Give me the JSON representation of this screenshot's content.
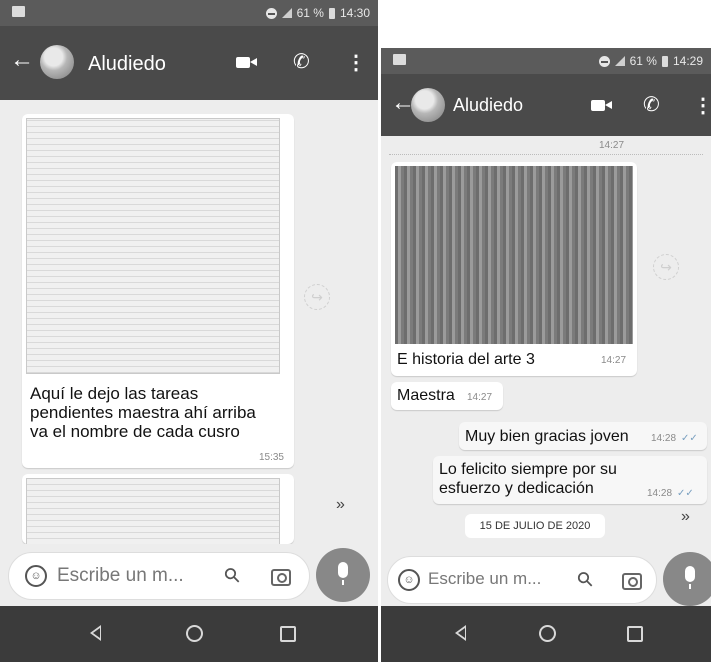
{
  "left": {
    "status": {
      "battery": "61 %",
      "time": "14:30"
    },
    "header": {
      "contact": "Aludiedo"
    },
    "message": {
      "caption": "Aquí le dejo las tareas pendientes maestra  ahí arriba va el nombre de cada cusro",
      "time": "15:35"
    },
    "composer": {
      "placeholder": "Escribe un m..."
    }
  },
  "right": {
    "status": {
      "battery": "61 %",
      "time": "14:29"
    },
    "header": {
      "contact": "Aludiedo"
    },
    "top_time": "14:27",
    "image_message": {
      "caption": "E historia del arte 3",
      "time": "14:27"
    },
    "text_message_1": {
      "text": "Maestra",
      "time": "14:27"
    },
    "reply_1": {
      "text": "Muy bien gracias joven",
      "time": "14:28"
    },
    "reply_2": {
      "text": "Lo felicito siempre por su esfuerzo y dedicación",
      "time": "14:28"
    },
    "date_divider": "15 DE JULIO DE 2020",
    "composer": {
      "placeholder": "Escribe un m..."
    }
  },
  "colors": {
    "app_bar": "#4a4a4a",
    "status_bar": "#5b5b5b",
    "chat_background": "#ededed",
    "mic_button": "#888888",
    "nav_bar": "#3b3b3b"
  },
  "icons": [
    "gallery-icon",
    "dnd-icon",
    "signal-icon",
    "battery-icon",
    "back-arrow-icon",
    "video-call-icon",
    "voice-call-icon",
    "more-options-icon",
    "forward-icon",
    "scroll-down-icon",
    "emoji-icon",
    "attach-icon",
    "camera-icon",
    "mic-icon",
    "nav-back-icon",
    "nav-home-icon",
    "nav-recents-icon"
  ]
}
